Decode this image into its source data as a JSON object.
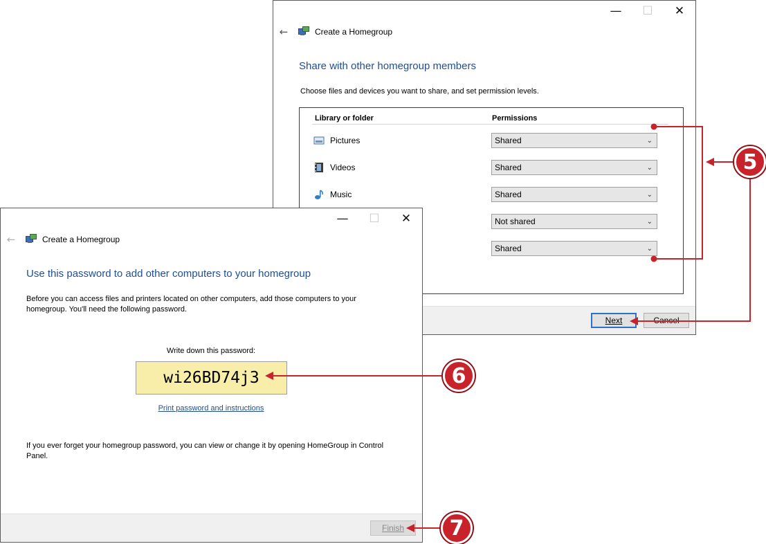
{
  "window_back": {
    "title": "Create a Homegroup",
    "heading": "Share with other homegroup members",
    "instructions": "Choose files and devices you want to share, and set permission levels.",
    "col_library": "Library or folder",
    "col_permissions": "Permissions",
    "libraries": [
      {
        "label": "Pictures",
        "icon": "pictures-icon",
        "permission": "Shared"
      },
      {
        "label": "Videos",
        "icon": "videos-icon",
        "permission": "Shared"
      },
      {
        "label": "Music",
        "icon": "music-icon",
        "permission": "Shared"
      },
      {
        "label": "",
        "icon": "",
        "permission": "Not shared"
      },
      {
        "label": "",
        "icon": "",
        "permission": "Shared"
      }
    ],
    "next_label": "Next",
    "cancel_label": "Cancel"
  },
  "window_front": {
    "title": "Create a Homegroup",
    "heading": "Use this password to add other computers to your homegroup",
    "instructions": "Before you can access files and printers located on other computers, add those computers to your homegroup. You'll need the following password.",
    "password_label": "Write down this password:",
    "password": "wi26BD74j3",
    "print_link": "Print password and instructions",
    "forget_note": "If you ever forget your homegroup password, you can view or change it by opening HomeGroup in Control Panel.",
    "finish_label": "Finish"
  },
  "caption_buttons": {
    "minimize": "—",
    "maximize": "☐",
    "close": "✕"
  },
  "callouts": [
    "5",
    "6",
    "7"
  ],
  "colors": {
    "accent": "#1f4e93",
    "callout": "#c8222a",
    "password_bg": "#f8eeaa",
    "arrow": "#c8222a"
  }
}
